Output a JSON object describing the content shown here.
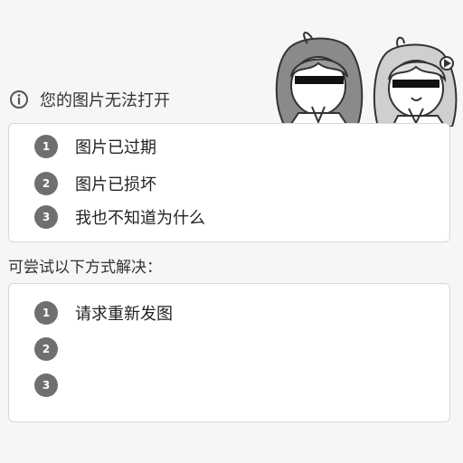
{
  "error": {
    "title": "您的图片无法打开"
  },
  "reasons": {
    "items": [
      {
        "num": "1",
        "text": "图片已过期"
      },
      {
        "num": "2",
        "text": "图片已损坏"
      },
      {
        "num": "3",
        "text": "我也不知道为什么"
      }
    ]
  },
  "solutions": {
    "title": "可尝试以下方式解决：",
    "items": [
      {
        "num": "1",
        "text": "请求重新发图"
      },
      {
        "num": "2",
        "text": ""
      },
      {
        "num": "3",
        "text": ""
      }
    ]
  },
  "icons": {
    "info": "info-circle-icon",
    "banner": "anime-girls-illustration"
  },
  "colors": {
    "background": "#f6f6f6",
    "card": "#ffffff",
    "border": "#d9d9d9",
    "number_badge": "#6f6f6f"
  }
}
